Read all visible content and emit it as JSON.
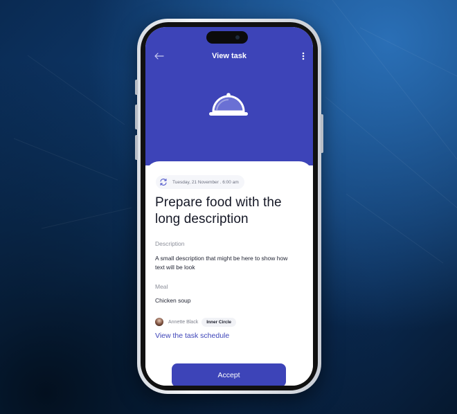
{
  "header": {
    "title": "View task",
    "back_icon": "arrow-left-icon",
    "menu_icon": "more-vertical-icon",
    "hero_icon": "cloche-icon",
    "color": "#3d44b8"
  },
  "task": {
    "date": "Tuesday, 21 November . 6:00 am",
    "date_icon": "repeat-icon",
    "title": "Prepare food with the long description",
    "description_label": "Description",
    "description": "A small description that might be here to show how text will be look",
    "meal_label": "Meal",
    "meal": "Chicken soup",
    "assignee": {
      "name": "Annette Black",
      "group": "Inner Circle"
    },
    "schedule_link": "View the task schedule"
  },
  "actions": {
    "accept_label": "Accept"
  },
  "colors": {
    "accent": "#3d44b8",
    "background": "#0f3d72"
  }
}
